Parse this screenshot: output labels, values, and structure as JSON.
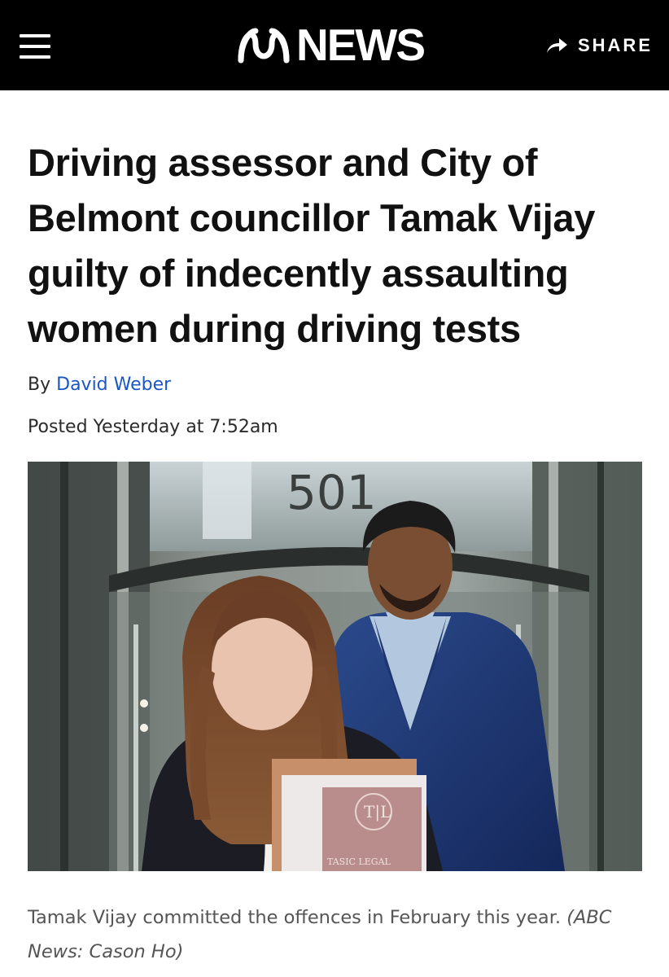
{
  "header": {
    "brand_text": "NEWS",
    "share_label": "SHARE",
    "background": "#000000"
  },
  "article": {
    "headline": "Driving assessor and City of Belmont councillor Tamak Vijay guilty of indecently assaulting women during driving tests",
    "byline_prefix": "By",
    "author": "David Weber",
    "posted": "Posted Yesterday at 7:52am",
    "author_color": "#1a56c4"
  },
  "photo": {
    "building_number": "501",
    "folder_text": "TASIC LEGAL"
  },
  "caption": {
    "text": "Tamak Vijay committed the offences in February this year.",
    "credit": "(ABC News: Cason Ho)"
  }
}
